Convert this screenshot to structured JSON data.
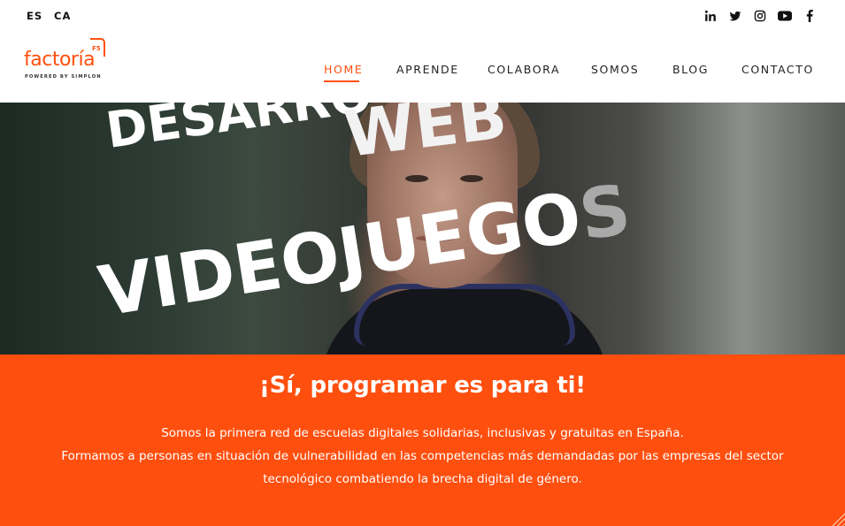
{
  "languages": {
    "es": "ES",
    "ca": "CA"
  },
  "social": [
    "linkedin-icon",
    "twitter-icon",
    "instagram-icon",
    "youtube-icon",
    "facebook-icon"
  ],
  "logo": {
    "wordmark": "factoría",
    "badge": "F5",
    "tagline": "POWERED BY SIMPLON"
  },
  "nav": {
    "items": [
      "HOME",
      "APRENDE",
      "COLABORA",
      "SOMOS",
      "BLOG",
      "CONTACTO"
    ],
    "active": "HOME"
  },
  "hero": {
    "word_top": "DESARRO",
    "word_web": "WEB",
    "word_bottom_main": "VIDEOJUEGO",
    "word_bottom_end": "S"
  },
  "band": {
    "title": "¡Sí, programar es para ti!",
    "line1": "Somos la primera red de escuelas digitales solidarias, inclusivas y gratuitas en España.",
    "line2": "Formamos a personas en situación de vulnerabilidad en las competencias más demandadas por las empresas del sector",
    "line3": "tecnológico combatiendo la brecha digital de género."
  },
  "colors": {
    "brand": "#ff4f0f",
    "text": "#222222",
    "white": "#ffffff"
  }
}
